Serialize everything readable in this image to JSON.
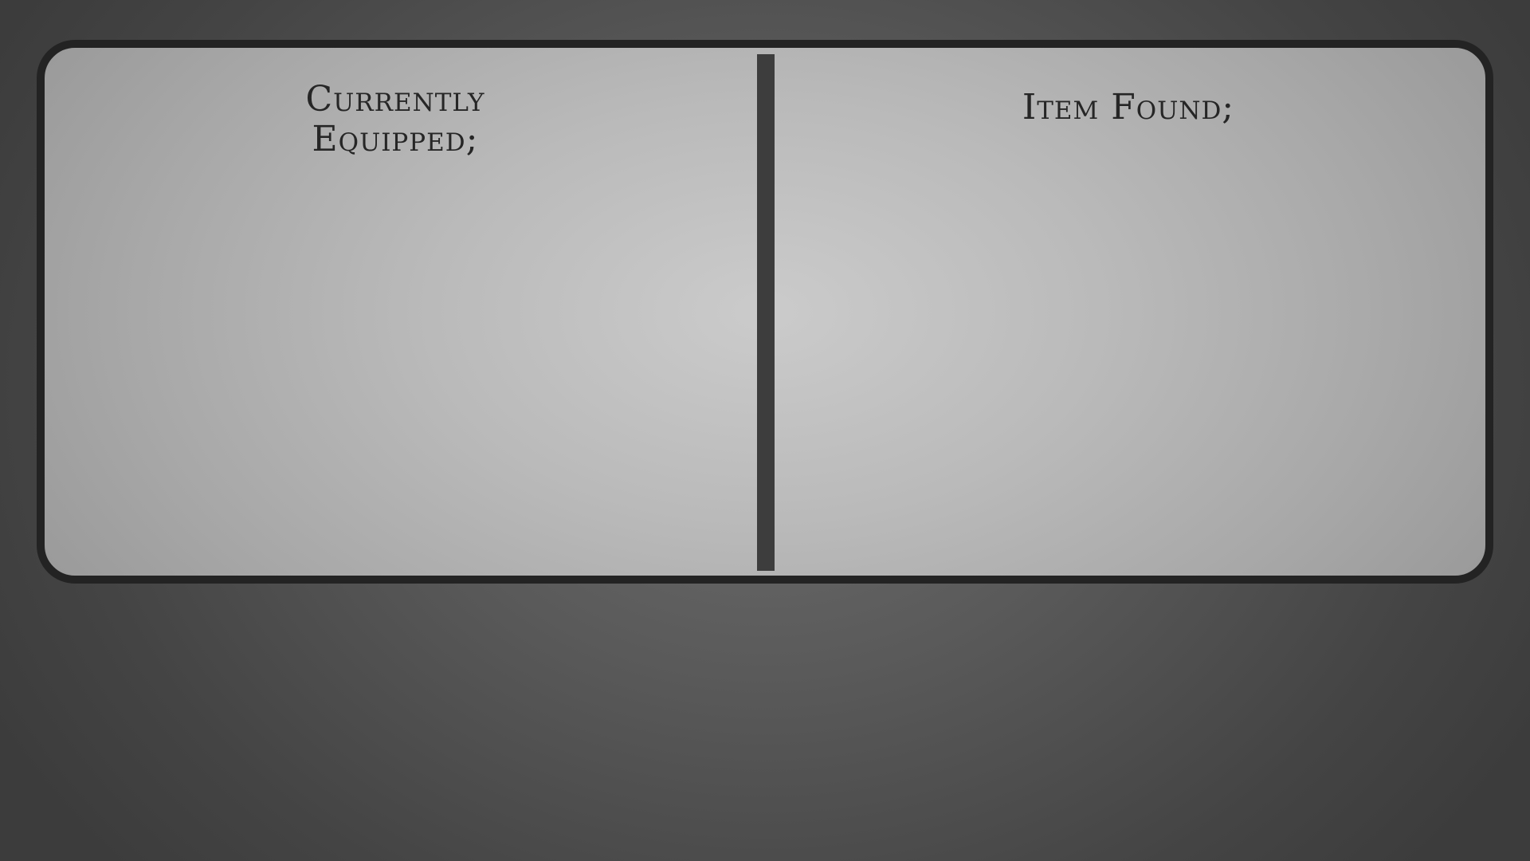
{
  "comparison_panel": {
    "equipped_heading_lines": [
      "Currently",
      "Equipped;"
    ],
    "found_heading": "Item Found;"
  },
  "colors": {
    "background": "#555555",
    "panel_fill": "#bdbdbd",
    "panel_border": "#232323",
    "divider": "#3d3d3d",
    "heading_text": "#262626"
  }
}
